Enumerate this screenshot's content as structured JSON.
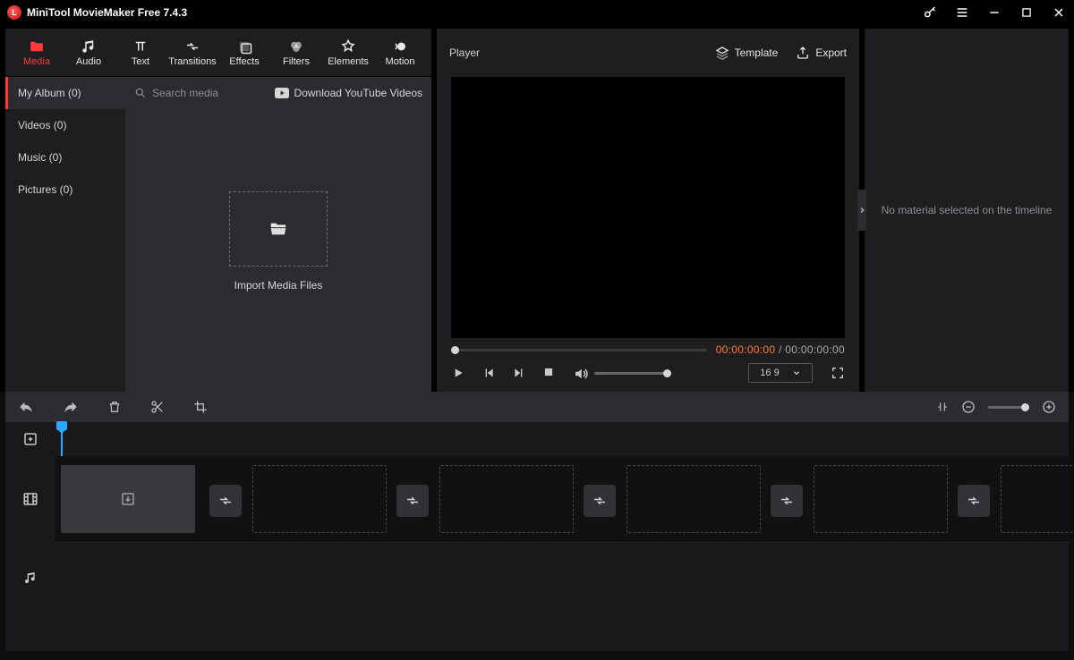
{
  "app": {
    "title": "MiniTool MovieMaker Free 7.4.3"
  },
  "tabs": {
    "media": {
      "label": "Media"
    },
    "audio": {
      "label": "Audio"
    },
    "text": {
      "label": "Text"
    },
    "transitions": {
      "label": "Transitions"
    },
    "effects": {
      "label": "Effects"
    },
    "filters": {
      "label": "Filters"
    },
    "elements": {
      "label": "Elements"
    },
    "motion": {
      "label": "Motion"
    }
  },
  "library": {
    "search_placeholder": "Search media",
    "download_label": "Download YouTube Videos",
    "sidebar": {
      "myalbum": {
        "label": "My Album (0)"
      },
      "videos": {
        "label": "Videos (0)"
      },
      "music": {
        "label": "Music (0)"
      },
      "pictures": {
        "label": "Pictures (0)"
      }
    },
    "import_label": "Import Media Files"
  },
  "player": {
    "title": "Player",
    "template_label": "Template",
    "export_label": "Export",
    "current_time": "00:00:00:00",
    "total_time": "00:00:00:00",
    "time_sep": " / ",
    "aspect": "16 9"
  },
  "properties": {
    "empty_text": "No material selected on the timeline"
  }
}
